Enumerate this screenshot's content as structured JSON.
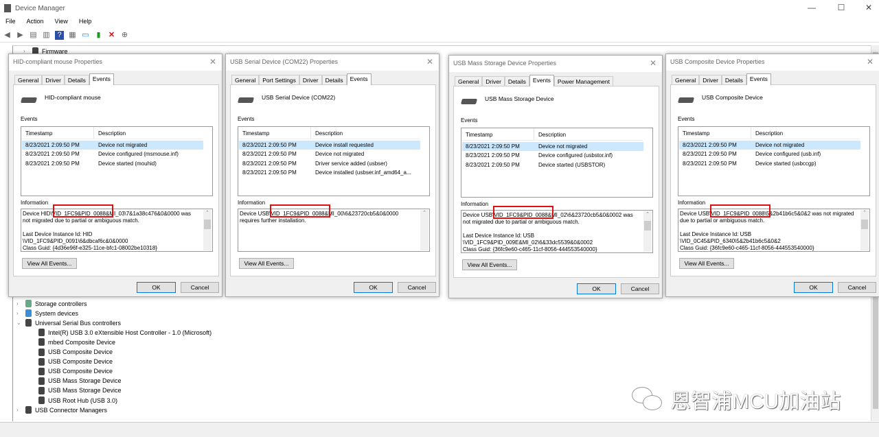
{
  "app": {
    "title": "Device Manager",
    "menu": [
      "File",
      "Action",
      "View",
      "Help"
    ],
    "window_controls": [
      "—",
      "☐",
      "✕"
    ],
    "toolbar_icons": [
      "back-icon",
      "forward-icon",
      "properties-icon",
      "show-hide-icon",
      "help-icon",
      "action-icon",
      "scan-hardware-icon",
      "update-driver-icon",
      "uninstall-icon",
      "disable-icon"
    ]
  },
  "tree": {
    "top_item": "Firmware",
    "items": [
      {
        "label": "Storage controllers",
        "expanded": false,
        "level": 0
      },
      {
        "label": "System devices",
        "expanded": false,
        "level": 0
      },
      {
        "label": "Universal Serial Bus controllers",
        "expanded": true,
        "level": 0
      },
      {
        "label": "Intel(R) USB 3.0 eXtensible Host Controller - 1.0 (Microsoft)",
        "level": 1
      },
      {
        "label": "mbed Composite Device",
        "level": 1
      },
      {
        "label": "USB Composite Device",
        "level": 1
      },
      {
        "label": "USB Composite Device",
        "level": 1
      },
      {
        "label": "USB Composite Device",
        "level": 1
      },
      {
        "label": "USB Mass Storage Device",
        "level": 1
      },
      {
        "label": "USB Mass Storage Device",
        "level": 1
      },
      {
        "label": "USB Root Hub (USB 3.0)",
        "level": 1
      },
      {
        "label": "USB Connector Managers",
        "expanded": false,
        "level": 0
      }
    ]
  },
  "common": {
    "events_label": "Events",
    "col_timestamp": "Timestamp",
    "col_description": "Description",
    "information_label": "Information",
    "view_all": "View All Events...",
    "ok": "OK",
    "cancel": "Cancel",
    "close": "✕"
  },
  "dialogs": [
    {
      "title": "HID-compliant mouse Properties",
      "tabs": [
        "General",
        "Driver",
        "Details",
        "Events"
      ],
      "selected_tab": "Events",
      "device": "HID-compliant mouse",
      "events": [
        {
          "ts": "8/23/2021 2:09:50 PM",
          "desc": "Device not migrated"
        },
        {
          "ts": "8/23/2021 2:09:50 PM",
          "desc": "Device configured (msmouse.inf)"
        },
        {
          "ts": "8/23/2021 2:09:50 PM",
          "desc": "Device started (mouhid)"
        }
      ],
      "info": "Device HID\\VID_1FC9&PID_0088&MI_03\\7&1a38c476&0&0000 was not migrated due to partial or ambiguous match.\n\nLast Device Instance Id: HID\n\\VID_1FC9&PID_0091\\6&dbcaf6c&0&0000\nClass Guid: {4d36e96f-e325-11ce-bfc1-08002be10318}",
      "highlight": "VID_1FC9&PID_0088",
      "scroll": true
    },
    {
      "title": "USB Serial Device (COM22) Properties",
      "tabs": [
        "General",
        "Port Settings",
        "Driver",
        "Details",
        "Events"
      ],
      "selected_tab": "Events",
      "device": "USB Serial Device (COM22)",
      "events": [
        {
          "ts": "8/23/2021 2:09:50 PM",
          "desc": "Device install requested"
        },
        {
          "ts": "8/23/2021 2:09:50 PM",
          "desc": "Device not migrated"
        },
        {
          "ts": "8/23/2021 2:09:50 PM",
          "desc": "Driver service added (usbser)"
        },
        {
          "ts": "8/23/2021 2:09:50 PM",
          "desc": "Device installed (usbser.inf_amd64_a..."
        }
      ],
      "info": "Device USB\\VID_1FC9&PID_0088&MI_00\\6&23720cb5&0&0000 requires further installation.",
      "highlight": "VID_1FC9&PID_0088",
      "scroll": false
    },
    {
      "title": "USB Mass Storage Device Properties",
      "tabs": [
        "General",
        "Driver",
        "Details",
        "Events",
        "Power Management"
      ],
      "selected_tab": "Events",
      "device": "USB Mass Storage Device",
      "events": [
        {
          "ts": "8/23/2021 2:09:50 PM",
          "desc": "Device not migrated"
        },
        {
          "ts": "8/23/2021 2:09:50 PM",
          "desc": "Device configured (usbstor.inf)"
        },
        {
          "ts": "8/23/2021 2:09:50 PM",
          "desc": "Device started (USBSTOR)"
        }
      ],
      "info": "Device USB\\VID_1FC9&PID_0088&MI_02\\6&23720cb5&0&0002 was not migrated due to partial or ambiguous match.\n\nLast Device Instance Id: USB\n\\VID_1FC9&PID_009E&MI_02\\6&33dc5539&0&0002\nClass Guid: {36fc9e60-c465-11cf-8056-444553540000}",
      "highlight": "VID_1FC9&PID_0088",
      "scroll": true
    },
    {
      "title": "USB Composite Device Properties",
      "tabs": [
        "General",
        "Driver",
        "Details",
        "Events"
      ],
      "selected_tab": "Events",
      "device": "USB Composite Device",
      "events": [
        {
          "ts": "8/23/2021 2:09:50 PM",
          "desc": "Device not migrated"
        },
        {
          "ts": "8/23/2021 2:09:50 PM",
          "desc": "Device configured (usb.inf)"
        },
        {
          "ts": "8/23/2021 2:09:50 PM",
          "desc": "Device started (usbccgp)"
        }
      ],
      "info": "Device USB\\VID_1FC9&PID_0088\\5&2b41b6c5&0&2 was not migrated due to partial or ambiguous match.\n\nLast Device Instance Id: USB\n\\VID_0C45&PID_6340\\5&2b41b6c5&0&2\nClass Guid: {36fc9e60-c465-11cf-8056-444553540000}",
      "highlight": "VID_1FC9&PID_0088",
      "scroll": true
    }
  ],
  "watermark": {
    "text": "恩智浦MCU加油站",
    "icon": "wechat-icon"
  },
  "colors": {
    "highlight_box": "#e01010",
    "selection": "#cce8ff",
    "default_button_border": "#0078d7"
  }
}
